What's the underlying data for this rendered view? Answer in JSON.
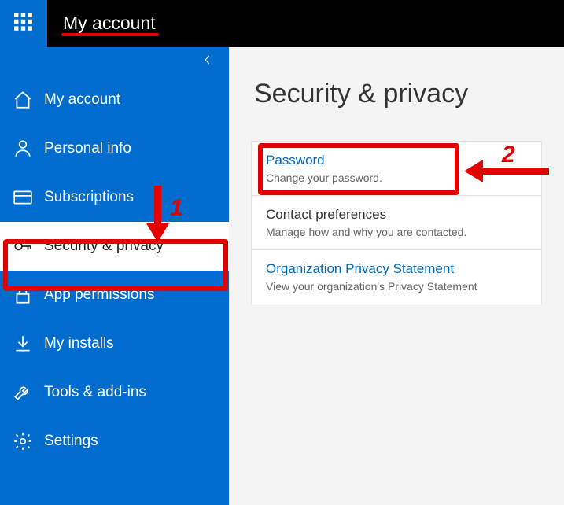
{
  "header": {
    "app_title": "My account"
  },
  "sidebar": {
    "items": [
      {
        "label": "My account",
        "icon": "home-icon",
        "active": false
      },
      {
        "label": "Personal info",
        "icon": "person-icon",
        "active": false
      },
      {
        "label": "Subscriptions",
        "icon": "card-icon",
        "active": false
      },
      {
        "label": "Security & privacy",
        "icon": "key-icon",
        "active": true
      },
      {
        "label": "App permissions",
        "icon": "lock-icon",
        "active": false
      },
      {
        "label": "My installs",
        "icon": "download-icon",
        "active": false
      },
      {
        "label": "Tools & add-ins",
        "icon": "wrench-icon",
        "active": false
      },
      {
        "label": "Settings",
        "icon": "gear-icon",
        "active": false
      }
    ]
  },
  "main": {
    "title": "Security & privacy",
    "cards": [
      {
        "title": "Password",
        "desc": "Change your password.",
        "link": true
      },
      {
        "title": "Contact preferences",
        "desc": "Manage how and why you are contacted.",
        "link": false
      },
      {
        "title": "Organization Privacy Statement",
        "desc": "View your organization's Privacy Statement",
        "link": true
      }
    ]
  },
  "annotations": {
    "step1": "1",
    "step2": "2"
  }
}
